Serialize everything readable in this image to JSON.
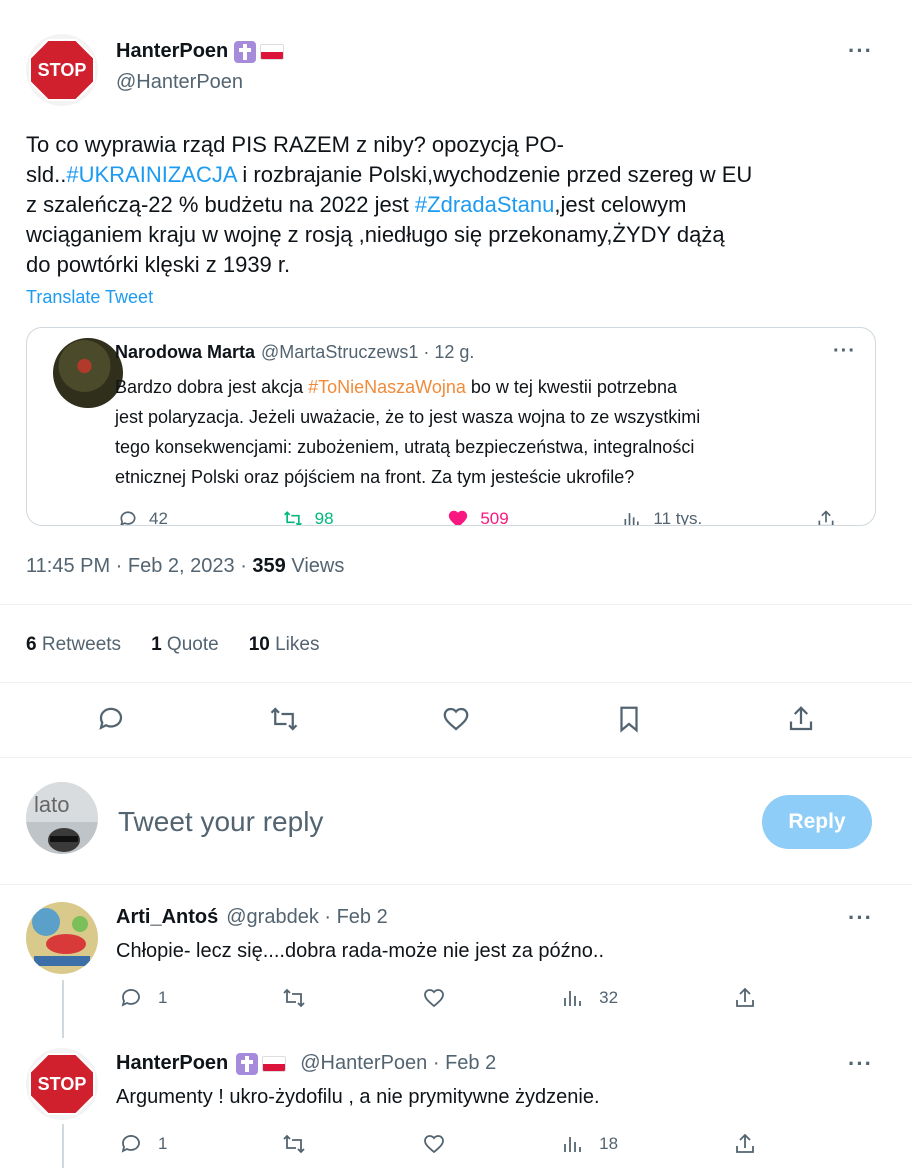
{
  "main_tweet": {
    "author_name": "HanterPoen",
    "author_handle": "@HanterPoen",
    "avatar_text": "STOP",
    "text_parts": [
      {
        "t": "To co wyprawia rząd PIS RAZEM z niby? opozycją PO-\nsld..",
        "link": false
      },
      {
        "t": "#UKRAINIZACJA",
        "link": true
      },
      {
        "t": " i rozbrajanie Polski,wychodzenie przed szereg w EU\nz szaleńczą-22 % budżetu na 2022 jest ",
        "link": false
      },
      {
        "t": "#ZdradaStanu",
        "link": true
      },
      {
        "t": ",jest celowym\nwciąganiem kraju w wojnę z rosją ,niedługo się przekonamy,ŻYDY dążą\ndo powtórki klęski z 1939 r.",
        "link": false
      }
    ],
    "translate_label": "Translate Tweet",
    "timestamp": "11:45 PM · Feb 2, 2023 · ",
    "views_count": "359",
    "views_label": " Views",
    "stats": {
      "retweets_count": "6",
      "retweets_label": " Retweets",
      "quotes_count": "1",
      "quotes_label": " Quote",
      "likes_count": "10",
      "likes_label": " Likes"
    }
  },
  "quoted_tweet": {
    "author_name": "Narodowa Marta",
    "author_handle": "@MartaStruczews1 · 12 g.",
    "text_before": "Bardzo dobra jest akcja ",
    "hashtag": "#ToNieNaszaWojna",
    "text_after": " bo w tej kwestii potrzebna\njest polaryzacja. Jeżeli uważacie, że to jest wasza wojna to ze wszystkimi\ntego konsekwencjami: zubożeniem, utratą bezpieczeństwa, integralności\netnicznej Polski oraz pójściem na front. Za tym jesteście ukrofile?",
    "replies": "42",
    "retweets": "98",
    "likes": "509",
    "views": "11 tys."
  },
  "reply_box": {
    "placeholder": "Tweet your reply",
    "button_label": "Reply"
  },
  "replies": [
    {
      "author_name": "Arti_Antoś",
      "author_handle": "@grabdek · Feb 2",
      "text": "Chłopie- lecz się....dobra rada-może nie jest za późno..",
      "reply_count": "1",
      "views": "32"
    },
    {
      "author_name": "HanterPoen",
      "author_handle": "@HanterPoen · Feb 2",
      "text": "Argumenty ! ukro-żydofilu , a nie prymitywne żydzenie.",
      "reply_count": "1",
      "views": "18"
    }
  ],
  "colors": {
    "link": "#1d9bf0",
    "hashtag_orange": "#f18b3a",
    "like_pink": "#f91880",
    "retweet_green": "#00ba7c",
    "reply_button": "#8ecdf8",
    "stop_red": "#d0202e"
  }
}
